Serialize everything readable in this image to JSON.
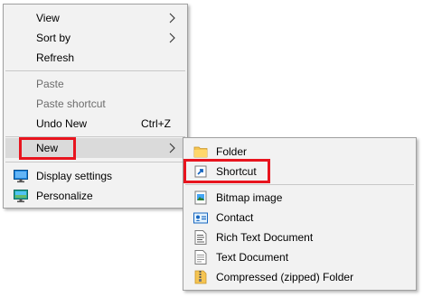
{
  "context_menu": {
    "view_label": "View",
    "sort_by_label": "Sort by",
    "refresh_label": "Refresh",
    "paste_label": "Paste",
    "paste_shortcut_label": "Paste shortcut",
    "undo_new_label": "Undo New",
    "undo_new_shortcut": "Ctrl+Z",
    "new_label": "New",
    "display_settings_label": "Display settings",
    "personalize_label": "Personalize"
  },
  "new_submenu": {
    "items": [
      {
        "label": "Folder",
        "icon": "folder-icon"
      },
      {
        "label": "Shortcut",
        "icon": "shortcut-icon"
      },
      {
        "label": "Bitmap image",
        "icon": "bitmap-icon"
      },
      {
        "label": "Contact",
        "icon": "contact-icon"
      },
      {
        "label": "Rich Text Document",
        "icon": "rich-text-icon"
      },
      {
        "label": "Text Document",
        "icon": "text-document-icon"
      },
      {
        "label": "Compressed (zipped) Folder",
        "icon": "zip-folder-icon"
      }
    ]
  },
  "colors": {
    "menu_background": "#f2f2f2",
    "hover_background": "#dadada",
    "highlight_border": "#e8141e",
    "disabled_text": "#6d6d6d"
  }
}
